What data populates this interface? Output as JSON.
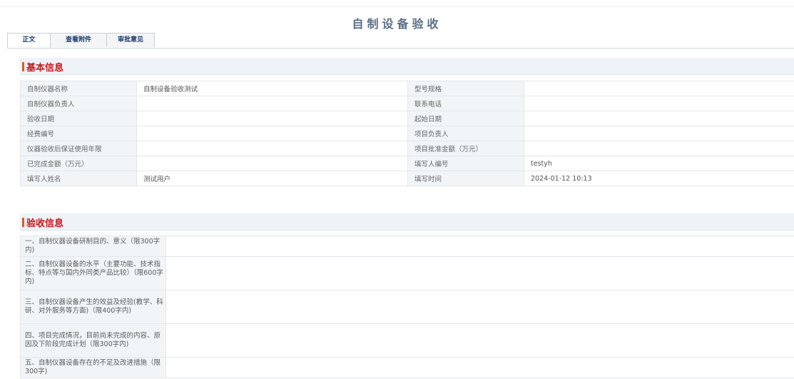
{
  "page_title": "自制设备验收",
  "tabs": [
    {
      "label": "正文",
      "active": true
    },
    {
      "label": "查看附件",
      "active": false
    },
    {
      "label": "审批意见",
      "active": false
    }
  ],
  "basic_section": {
    "title": "基本信息",
    "rows": [
      {
        "label1": "自制仪器名称",
        "value1": "自制设备验收测试",
        "label2": "型号规格",
        "value2": ""
      },
      {
        "label1": "自制仪器负责人",
        "value1": "",
        "label2": "联系电话",
        "value2": ""
      },
      {
        "label1": "验收日期",
        "value1": "",
        "label2": "起始日期",
        "value2": ""
      },
      {
        "label1": "经费编号",
        "value1": "",
        "label2": "项目负责人",
        "value2": ""
      },
      {
        "label1": "仪器验收后保证使用年限",
        "value1": "",
        "label2": "项目批准金额（万元）",
        "value2": ""
      },
      {
        "label1": "已完成金额（万元）",
        "value1": "",
        "label2": "填写人编号",
        "value2": "testyh"
      },
      {
        "label1": "填写人姓名",
        "value1": "测试用户",
        "label2": "填写时间",
        "value2": "2024-01-12 10:13"
      }
    ]
  },
  "accept_section": {
    "title": "验收信息",
    "rows": [
      {
        "label": "一、自制仪器设备研制目的、意义（限300字内)",
        "value": ""
      },
      {
        "label": "二、自制仪器设备的水平（主要功能、技术指标、特点等与国内外同类产品比较）（限600字内)",
        "value": ""
      },
      {
        "label": "三、自制仪器设备产生的效益及经验(教学、科研、对外服务等方面)（限400字内)",
        "value": ""
      },
      {
        "label": "四、项目完成情况，目前尚未完成的内容、原因及下阶段完成计划（限300字内)",
        "value": ""
      },
      {
        "label": "五、自制仪器设备存在的不足及改进措施（限300字)",
        "value": ""
      }
    ]
  },
  "colors": {
    "section_title": "#c7161c",
    "section_bar": "#e0582c",
    "page_title": "#5b6f86",
    "label_bg": "#f2f5f8"
  }
}
